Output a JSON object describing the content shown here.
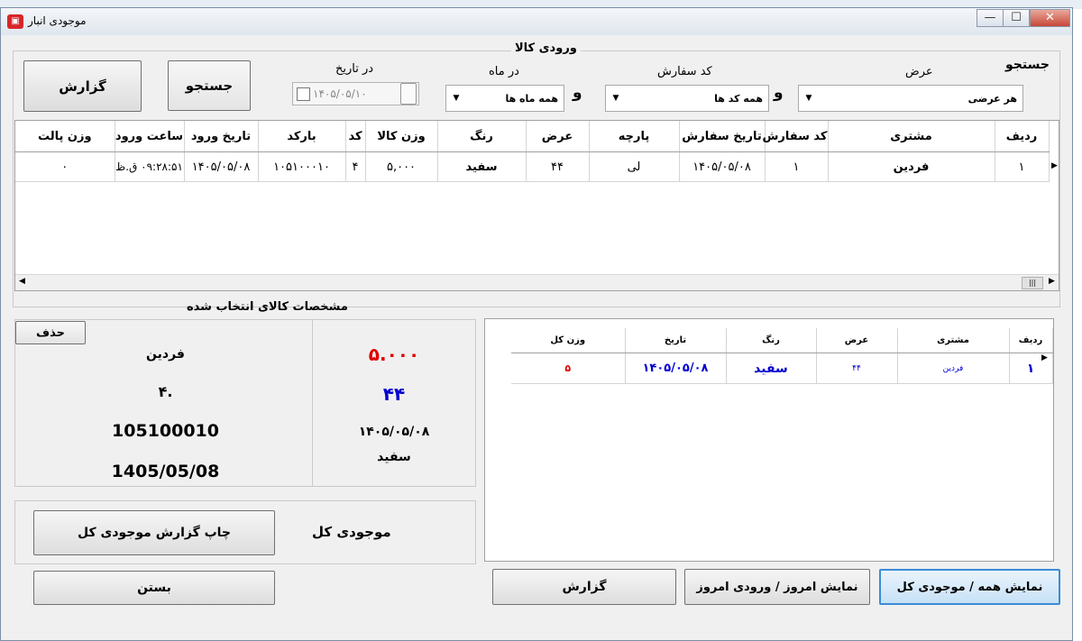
{
  "window": {
    "title": "موجودی انبار",
    "minimize": "—",
    "maximize": "☐",
    "close": "✕"
  },
  "search_group": {
    "title": "ورودی کالا",
    "search_label": "جستجو",
    "width_label": "عرض",
    "width_value": "هر عرضی",
    "and1": "و",
    "order_label": "کد سفارش",
    "order_value": "همه کد ها",
    "and2": "و",
    "month_label": "در ماه",
    "month_value": "همه ماه ها",
    "date_label": "در تاریخ",
    "date_value": "۱۴۰۵/۰۵/۱۰",
    "search_button": "جستجو",
    "report_button": "گزارش"
  },
  "main_table": {
    "columns": [
      "ردیف",
      "مشتری",
      "کد سفارش",
      "تاریخ سفارش",
      "پارچه",
      "عرض",
      "رنگ",
      "وزن کالا",
      "کد",
      "بارکد",
      "تاریخ ورود",
      "ساعت ورود",
      "وزن پالت"
    ],
    "rows": [
      [
        "۱",
        "فردین",
        "۱",
        "۱۴۰۵/۰۵/۰۸",
        "لی",
        "۴۴",
        "سفید",
        "۵,۰۰۰",
        "۴",
        "۱۰۵۱۰۰۰۱۰",
        "۱۴۰۵/۰۵/۰۸",
        "۰۹:۲۸:۵۱ ق.ظ",
        "۰"
      ]
    ]
  },
  "selected": {
    "title": "مشخصات کالای انتخاب شده",
    "delete_button": "حذف",
    "customer": "فردین",
    "code": "۴.",
    "barcode": "105100010",
    "date_latin": "1405/05/08",
    "weight": "۵.۰۰۰",
    "width": "۴۴",
    "date": "۱۴۰۵/۰۵/۰۸",
    "color": "سفید"
  },
  "total": {
    "label": "موجودی کل",
    "print_button": "چاپ گزارش موجودی کل"
  },
  "side_table": {
    "columns": [
      "ردیف",
      "مشتری",
      "عرض",
      "رنگ",
      "تاریخ",
      "وزن کل"
    ],
    "rows": [
      [
        "۱",
        "فردین",
        "۴۴",
        "سفید",
        "۱۴۰۵/۰۵/۰۸",
        "۵"
      ]
    ]
  },
  "bottom": {
    "close_button": "بستن",
    "report_button": "گزارش",
    "today_button": "نمایش امروز / ورودی امروز",
    "all_button": "نمایش همه / موجودی کل"
  },
  "colors": {
    "accent_red": "#e00000",
    "accent_blue": "#0000d0",
    "active_border": "#3c8bd6"
  }
}
